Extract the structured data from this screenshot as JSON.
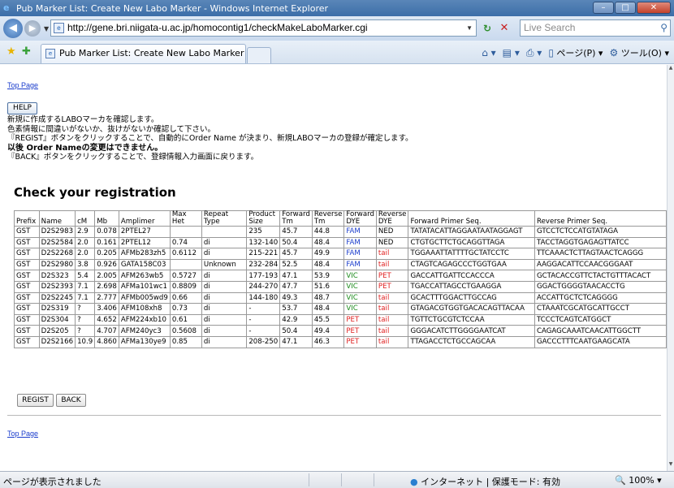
{
  "window": {
    "title": "Pub Marker List: Create New Labo Marker - Windows Internet Explorer"
  },
  "address": {
    "url": "http://gene.bri.niigata-u.ac.jp/homocontig1/checkMakeLaboMarker.cgi",
    "search_placeholder": "Live Search"
  },
  "tab": {
    "label": "Pub Marker List: Create New Labo Marker"
  },
  "commands": {
    "page": "ページ(P)",
    "tools": "ツール(O)"
  },
  "page": {
    "top_link": "Top Page",
    "help_button": "HELP",
    "notes": [
      "新規に作成するLABOマーカを確認します。",
      "色素情報に間違いがないか、抜けがないか確認して下さい。",
      "『REGIST』ボタンをクリックすることで、自動的にOrder Name が決まり、新規LABOマーカの登録が確定します。",
      "以後 Order Nameの変更はできません。",
      "『BACK』ボタンをクリックすることで、登録情報入力画面に戻ります。"
    ],
    "heading": "Check your registration",
    "table": {
      "headers": [
        "Prefix",
        "Name",
        "cM",
        "Mb",
        "Amplimer",
        "Max Het",
        "Repeat Type",
        "Product Size",
        "Forward Tm",
        "Reverse Tm",
        "Forward DYE",
        "Reverse DYE",
        "Forward Primer Seq.",
        "Reverse Primer Seq."
      ],
      "rows": [
        [
          "GST",
          "D2S2983",
          "2.9",
          "0.078",
          "2PTEL27",
          "",
          "",
          "235",
          "45.7",
          "44.8",
          "FAM",
          "NED",
          "TATATACATTAGGAATAATAGGAGT",
          "GTCCTCTCCATGTATAGA"
        ],
        [
          "GST",
          "D2S2584",
          "2.0",
          "0.161",
          "2PTEL12",
          "0.74",
          "di",
          "132-140",
          "50.4",
          "48.4",
          "FAM",
          "NED",
          "CTGTGCTTCTGCAGGTTAGA",
          "TACCTAGGTGAGAGTTATCC"
        ],
        [
          "GST",
          "D2S2268",
          "2.0",
          "0.205",
          "AFMb283zh5",
          "0.6112",
          "di",
          "215-221",
          "45.7",
          "49.9",
          "FAM",
          "tail",
          "TGGAAATTATTTTGCTATCCTC",
          "TTCAAACTCTTAGTAACTCAGGG"
        ],
        [
          "GST",
          "D2S2980",
          "3.8",
          "0.926",
          "GATA158C03",
          "",
          "Unknown",
          "232-284",
          "52.5",
          "48.4",
          "FAM",
          "tail",
          "CTAGTCAGAGCCCTGGTGAA",
          "AAGGACATTCCAACGGGAAT"
        ],
        [
          "GST",
          "D2S323",
          "5.4",
          "2.005",
          "AFM263wb5",
          "0.5727",
          "di",
          "177-193",
          "47.1",
          "53.9",
          "VIC",
          "PET",
          "GACCATTGATTCCACCCA",
          "GCTACACCGTTCTACTGTTTACACT"
        ],
        [
          "GST",
          "D2S2393",
          "7.1",
          "2.698",
          "AFMa101wc1",
          "0.8809",
          "di",
          "244-270",
          "47.7",
          "51.6",
          "VIC",
          "PET",
          "TGACCATTAGCCTGAAGGA",
          "GGACTGGGGTAACACCTG"
        ],
        [
          "GST",
          "D2S2245",
          "7.1",
          "2.777",
          "AFMb005wd9",
          "0.66",
          "di",
          "144-180",
          "49.3",
          "48.7",
          "VIC",
          "tail",
          "GCACTTTGGACTTGCCAG",
          "ACCATTGCTCTCAGGGG"
        ],
        [
          "GST",
          "D2S319",
          "?",
          "3.406",
          "AFM108xh8",
          "0.73",
          "di",
          "-",
          "53.7",
          "48.4",
          "VIC",
          "tail",
          "GTAGACGTGGTGACACAGTTACAA",
          "CTAAATCGCATGCATTGCCT"
        ],
        [
          "GST",
          "D2S304",
          "?",
          "4.652",
          "AFM224xb10",
          "0.61",
          "di",
          "-",
          "42.9",
          "45.5",
          "PET",
          "tail",
          "TGTTCTGCGTCTCCAA",
          "TCCCTCAGTCATGGCT"
        ],
        [
          "GST",
          "D2S205",
          "?",
          "4.707",
          "AFM240yc3",
          "0.5608",
          "di",
          "-",
          "50.4",
          "49.4",
          "PET",
          "tail",
          "GGGACATCTTGGGGAATCAT",
          "CAGAGCAAATCAACATTGGCTT"
        ],
        [
          "GST",
          "D2S2166",
          "10.9",
          "4.860",
          "AFMa130ye9",
          "0.85",
          "di",
          "208-250",
          "47.1",
          "46.3",
          "PET",
          "tail",
          "TTAGACCTCTGCCAGCAA",
          "GACCCTTTCAATGAAGCATA"
        ]
      ]
    },
    "buttons": {
      "regist": "REGIST",
      "back": "BACK"
    },
    "bottom_link": "Top Page"
  },
  "status": {
    "text": "ページが表示されました",
    "zone": "インターネット | 保護モード: 有効",
    "zoom": "100%"
  },
  "colors": {
    "fam": "#1a3ccc",
    "red_dye": "#e02020",
    "vic": "#1a8a1a"
  }
}
